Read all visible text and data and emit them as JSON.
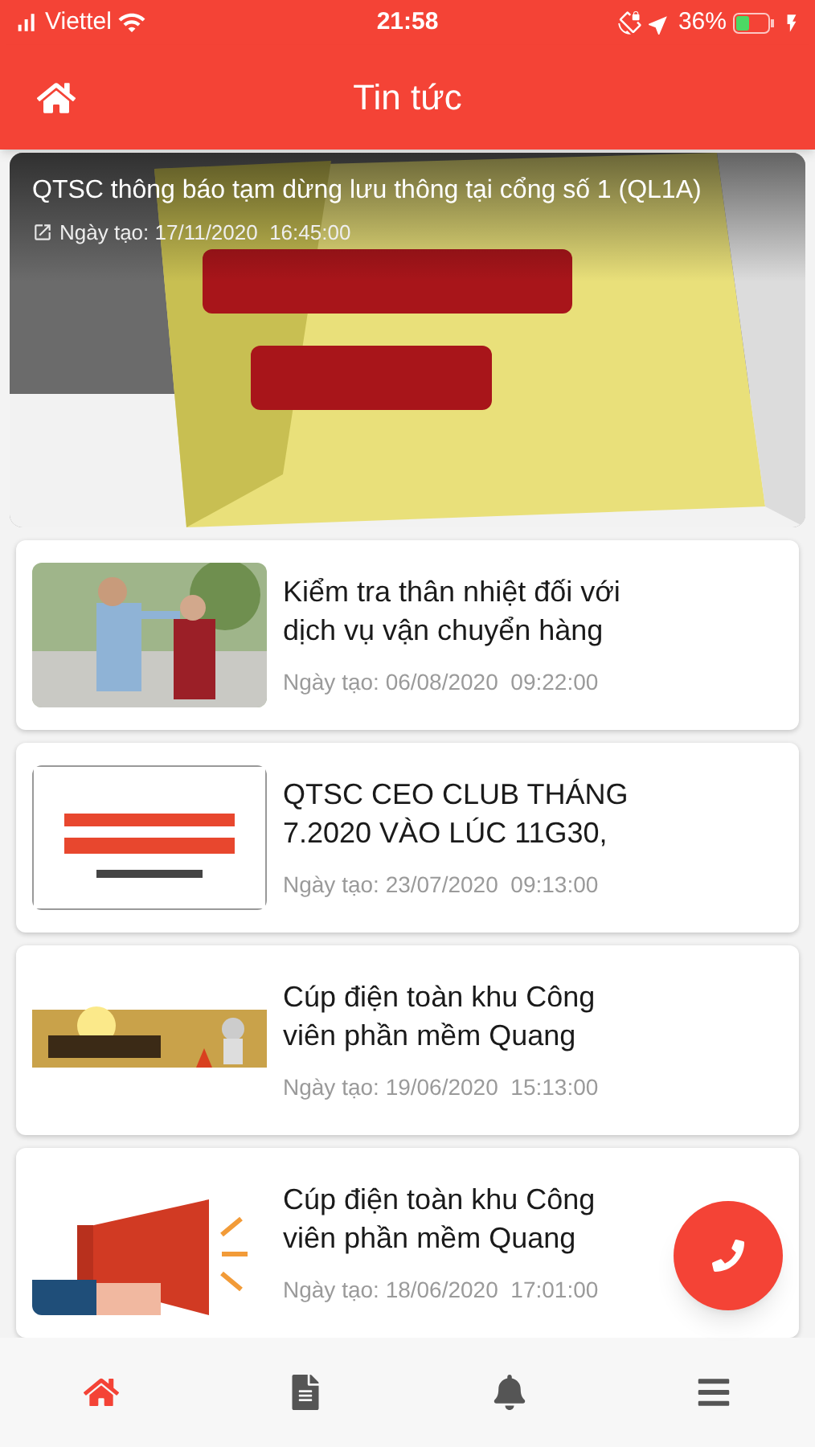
{
  "status_bar": {
    "carrier": "Viettel",
    "time": "21:58",
    "battery": "36%"
  },
  "header": {
    "title": "Tin tức"
  },
  "featured": {
    "title": "QTSC thông báo tạm dừng lưu thông tại cổng số 1 (QL1A)",
    "date": "Ngày tạo: 17/11/2020  16:45:00"
  },
  "news": [
    {
      "title": "Kiểm tra thân nhiệt đối với dịch vụ vận chuyển hàng",
      "date": "Ngày tạo: 06/08/2020  09:22:00"
    },
    {
      "title": "QTSC CEO CLUB THÁNG 7.2020 VÀO LÚC 11G30,",
      "date": "Ngày tạo: 23/07/2020  09:13:00"
    },
    {
      "title": "Cúp điện toàn khu Công viên phần mềm Quang",
      "date": "Ngày tạo: 19/06/2020  15:13:00"
    },
    {
      "title": "Cúp điện toàn khu Công viên phần mềm Quang",
      "date": "Ngày tạo: 18/06/2020  17:01:00"
    }
  ],
  "nav": [
    {
      "kind": "home",
      "selected": true
    },
    {
      "kind": "document",
      "selected": false
    },
    {
      "kind": "bell",
      "selected": false
    },
    {
      "kind": "menu",
      "selected": false
    }
  ]
}
